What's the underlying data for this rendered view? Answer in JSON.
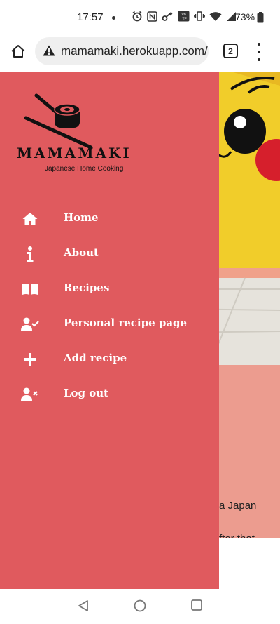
{
  "status_bar": {
    "time": "17:57",
    "battery": "73%",
    "icons": [
      "alarm-icon",
      "nfc-icon",
      "key-icon",
      "volte-icon",
      "vibrate-icon",
      "wifi-icon",
      "signal-icon",
      "battery-icon"
    ]
  },
  "browser": {
    "url": "mamamaki.herokuapp.com/",
    "tab_count": "2"
  },
  "drawer": {
    "logo_title": "MAMAMAKI",
    "logo_tagline": "Japanese Home Cooking",
    "accent_color": "#e05a5e",
    "nav": [
      {
        "label": "Home",
        "icon": "home-icon"
      },
      {
        "label": "About",
        "icon": "info-icon"
      },
      {
        "label": "Recipes",
        "icon": "book-icon"
      },
      {
        "label": "Personal recipe page",
        "icon": "user-check-icon"
      },
      {
        "label": "Add recipe",
        "icon": "plus-icon"
      },
      {
        "label": "Log out",
        "icon": "user-times-icon"
      }
    ]
  },
  "page": {
    "text_line_1": "a Japan",
    "text_line_2": "fter that"
  }
}
